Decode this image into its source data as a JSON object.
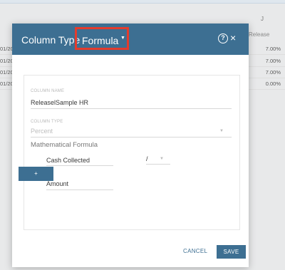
{
  "background": {
    "column_letter": "J",
    "column_header": "Release",
    "rows": [
      {
        "date": "01/20",
        "value": "7.00%"
      },
      {
        "date": "01/20",
        "value": "7.00%"
      },
      {
        "date": "01/20",
        "value": "7.00%"
      },
      {
        "date": "01/20",
        "value": "0.00%"
      }
    ]
  },
  "modal": {
    "title": "Column Type",
    "type_value": "Formula",
    "help_icon": "?",
    "close_icon": "×",
    "column_name": {
      "label": "COLUMN NAME",
      "value": "ReleaselSample HR"
    },
    "column_type": {
      "label": "COLUMN TYPE",
      "placeholder": "Percent"
    },
    "formula_title": "Mathematical Formula",
    "operand1": "Cash Collected",
    "operator": "/",
    "operand2": "Amount",
    "add_label": "+",
    "cancel_label": "CANCEL",
    "save_label": "SAVE"
  },
  "colors": {
    "header": "#3d6f92",
    "highlight": "#e43b2c"
  }
}
